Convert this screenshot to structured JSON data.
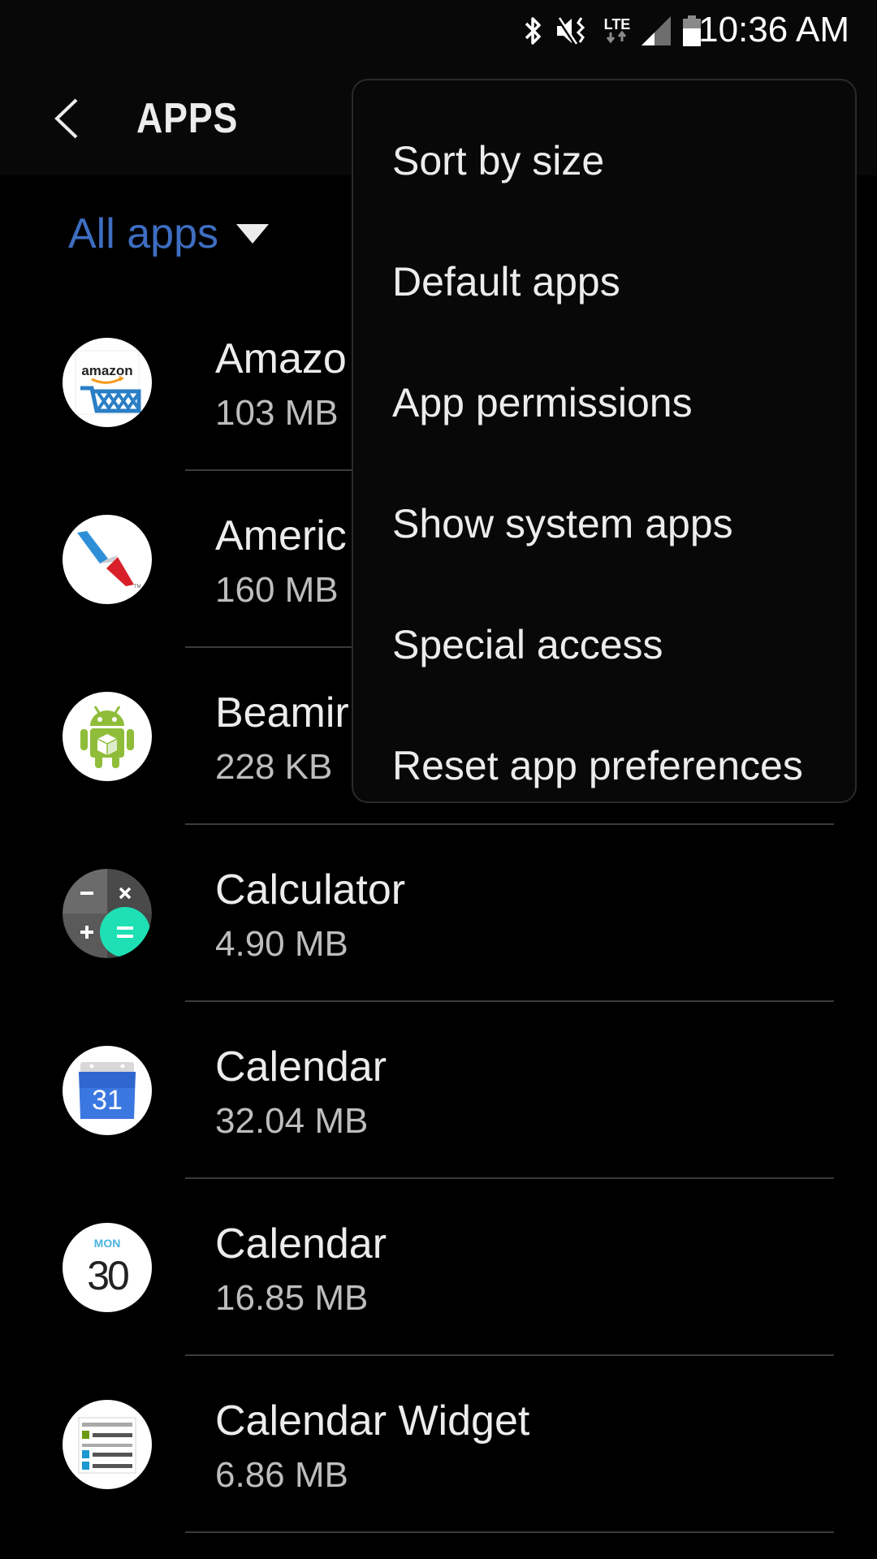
{
  "status_bar": {
    "time": "10:36 AM",
    "icons": [
      "bluetooth-icon",
      "vibrate-mute-icon",
      "lte-data-icon",
      "signal-icon",
      "battery-icon"
    ],
    "network_label": "LTE"
  },
  "app_bar": {
    "title": "APPS",
    "back_icon": "chevron-left-icon"
  },
  "filter": {
    "label": "All apps",
    "color": "#3e6ec2"
  },
  "apps": [
    {
      "name": "Amazon Shopping",
      "visible_name": "Amazo",
      "size": "103 MB",
      "icon": "amazon-icon"
    },
    {
      "name": "American",
      "visible_name": "Americ",
      "size": "160 MB",
      "icon": "american-airlines-icon"
    },
    {
      "name": "Beaming",
      "visible_name": "Beamir",
      "size": "228 KB",
      "icon": "android-package-icon"
    },
    {
      "name": "Calculator",
      "visible_name": "Calculator",
      "size": "4.90 MB",
      "icon": "calculator-icon"
    },
    {
      "name": "Calendar",
      "visible_name": "Calendar",
      "size": "32.04 MB",
      "icon": "google-calendar-icon"
    },
    {
      "name": "Calendar",
      "visible_name": "Calendar",
      "size": "16.85 MB",
      "icon": "samsung-calendar-icon",
      "icon_day": "MON",
      "icon_date": "30"
    },
    {
      "name": "Calendar Widget",
      "visible_name": "Calendar Widget",
      "size": "6.86 MB",
      "icon": "calendar-widget-icon"
    }
  ],
  "google_calendar_date": "31",
  "overflow_menu": {
    "items": [
      {
        "label": "Sort by size"
      },
      {
        "label": "Default apps"
      },
      {
        "label": "App permissions"
      },
      {
        "label": "Show system apps"
      },
      {
        "label": "Special access"
      },
      {
        "label": "Reset app preferences"
      }
    ]
  }
}
